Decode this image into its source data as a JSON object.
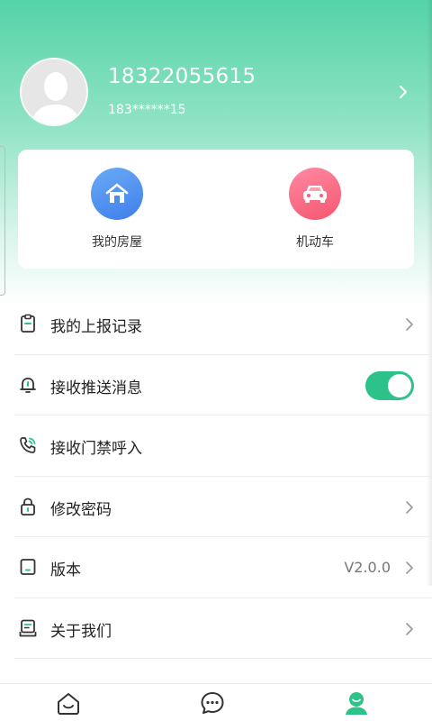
{
  "profile": {
    "phone": "18322055615",
    "phone_masked": "183******15"
  },
  "quick_links": [
    {
      "label": "我的房屋",
      "icon": "house-icon",
      "color": "#4a8ff0"
    },
    {
      "label": "机动车",
      "icon": "car-icon",
      "color": "#f7627b"
    }
  ],
  "menu": {
    "report_records": {
      "label": "我的上报记录",
      "icon": "clipboard-icon"
    },
    "push_messages": {
      "label": "接收推送消息",
      "icon": "bell-icon",
      "toggle_on": true
    },
    "door_call": {
      "label": "接收门禁呼入",
      "icon": "phone-call-icon"
    },
    "change_password": {
      "label": "修改密码",
      "icon": "lock-icon"
    },
    "version": {
      "label": "版本",
      "icon": "device-icon",
      "value": "V2.0.0"
    },
    "about": {
      "label": "关于我们",
      "icon": "contact-card-icon"
    }
  },
  "tabbar": {
    "items": [
      {
        "icon": "home-icon",
        "active": false
      },
      {
        "icon": "chat-icon",
        "active": false
      },
      {
        "icon": "profile-icon",
        "active": true
      }
    ],
    "active_color": "#2cc28a"
  },
  "colors": {
    "accent": "#2cc28a",
    "header_top": "#55d3a8"
  }
}
